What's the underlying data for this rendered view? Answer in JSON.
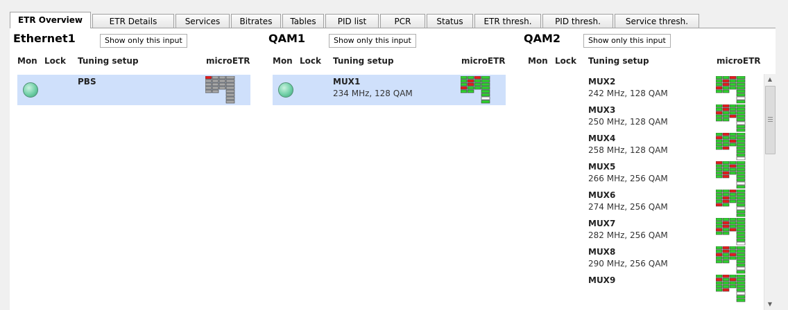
{
  "tabs": [
    {
      "label": "ETR Overview",
      "active": true
    },
    {
      "label": "ETR Details",
      "active": false
    },
    {
      "label": "Services",
      "active": false
    },
    {
      "label": "Bitrates",
      "active": false
    },
    {
      "label": "Tables",
      "active": false
    },
    {
      "label": "PID list",
      "active": false
    },
    {
      "label": "PCR",
      "active": false
    },
    {
      "label": "Status",
      "active": false
    },
    {
      "label": "ETR thresh.",
      "active": false
    },
    {
      "label": "PID thresh.",
      "active": false
    },
    {
      "label": "Service thresh.",
      "active": false
    }
  ],
  "headers": {
    "mon": "Mon",
    "lock": "Lock",
    "tuning": "Tuning setup",
    "microetr": "microETR"
  },
  "show_only_label": "Show only this input",
  "colors": {
    "ok": "#2fd22f",
    "error": "#e81b1b",
    "inactive": "#a9a9a9",
    "selected_row": "#cfe0fb"
  },
  "inputs": [
    {
      "name": "Ethernet1",
      "rows": [
        {
          "name": "PBS",
          "detail": "",
          "selected": true,
          "mon": true,
          "etr": "inactive"
        }
      ]
    },
    {
      "name": "QAM1",
      "rows": [
        {
          "name": "MUX1",
          "detail": "234 MHz, 128 QAM",
          "selected": true,
          "mon": true,
          "etr": "active"
        }
      ]
    },
    {
      "name": "QAM2",
      "rows": [
        {
          "name": "MUX2",
          "detail": "242 MHz, 128 QAM",
          "selected": false,
          "mon": false,
          "etr": "active"
        },
        {
          "name": "MUX3",
          "detail": "250 MHz, 128 QAM",
          "selected": false,
          "mon": false,
          "etr": "active"
        },
        {
          "name": "MUX4",
          "detail": "258 MHz, 128 QAM",
          "selected": false,
          "mon": false,
          "etr": "active"
        },
        {
          "name": "MUX5",
          "detail": "266 MHz, 256 QAM",
          "selected": false,
          "mon": false,
          "etr": "active"
        },
        {
          "name": "MUX6",
          "detail": "274 MHz, 256 QAM",
          "selected": false,
          "mon": false,
          "etr": "active"
        },
        {
          "name": "MUX7",
          "detail": "282 MHz, 256 QAM",
          "selected": false,
          "mon": false,
          "etr": "active"
        },
        {
          "name": "MUX8",
          "detail": "290 MHz, 256 QAM",
          "selected": false,
          "mon": false,
          "etr": "active"
        },
        {
          "name": "MUX9",
          "detail": "",
          "selected": false,
          "mon": false,
          "etr": "active"
        }
      ]
    }
  ],
  "scrollbar": {
    "icon_up": "arrow-up-icon",
    "icon_down": "arrow-down-icon"
  }
}
